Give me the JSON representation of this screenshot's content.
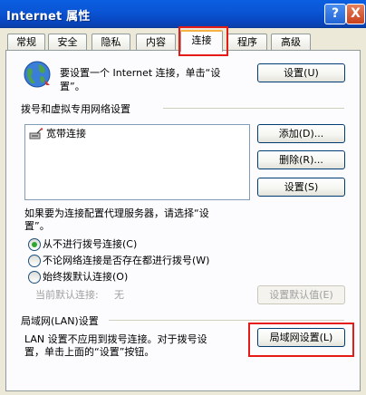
{
  "window": {
    "title": "Internet 属性",
    "help_button": "?",
    "close_button": "X"
  },
  "tabs": [
    {
      "label": "常规"
    },
    {
      "label": "安全"
    },
    {
      "label": "隐私"
    },
    {
      "label": "内容"
    },
    {
      "label": "连接",
      "active": true
    },
    {
      "label": "程序"
    },
    {
      "label": "高级"
    }
  ],
  "setup": {
    "text_line1": "要设置一个 Internet 连接，单击“设",
    "text_line2": "置”。",
    "button": "设置(U)"
  },
  "dialup": {
    "group_label": "拨号和虚拟专用网络设置",
    "connections": [
      "宽带连接"
    ],
    "add_button": "添加(D)...",
    "remove_button": "删除(R)...",
    "settings_button": "设置(S)",
    "proxy_text_line1": "如果要为连接配置代理服务器，请选择“设",
    "proxy_text_line2": "置”。",
    "options": [
      {
        "label": "从不进行拨号连接(C)",
        "selected": true
      },
      {
        "label": "不论网络连接是否存在都进行拨号(W)",
        "selected": false
      },
      {
        "label": "始终拨默认连接(O)",
        "selected": false
      }
    ],
    "current_default_label": "当前默认连接:",
    "current_default_value": "无",
    "set_default_button": "设置默认值(E)"
  },
  "lan": {
    "group_label": "局域网(LAN)设置",
    "text_line1": "LAN 设置不应用到拨号连接。对于拨号设",
    "text_line2": "置，单击上面的“设置”按钮。",
    "button": "局域网设置(L)"
  }
}
